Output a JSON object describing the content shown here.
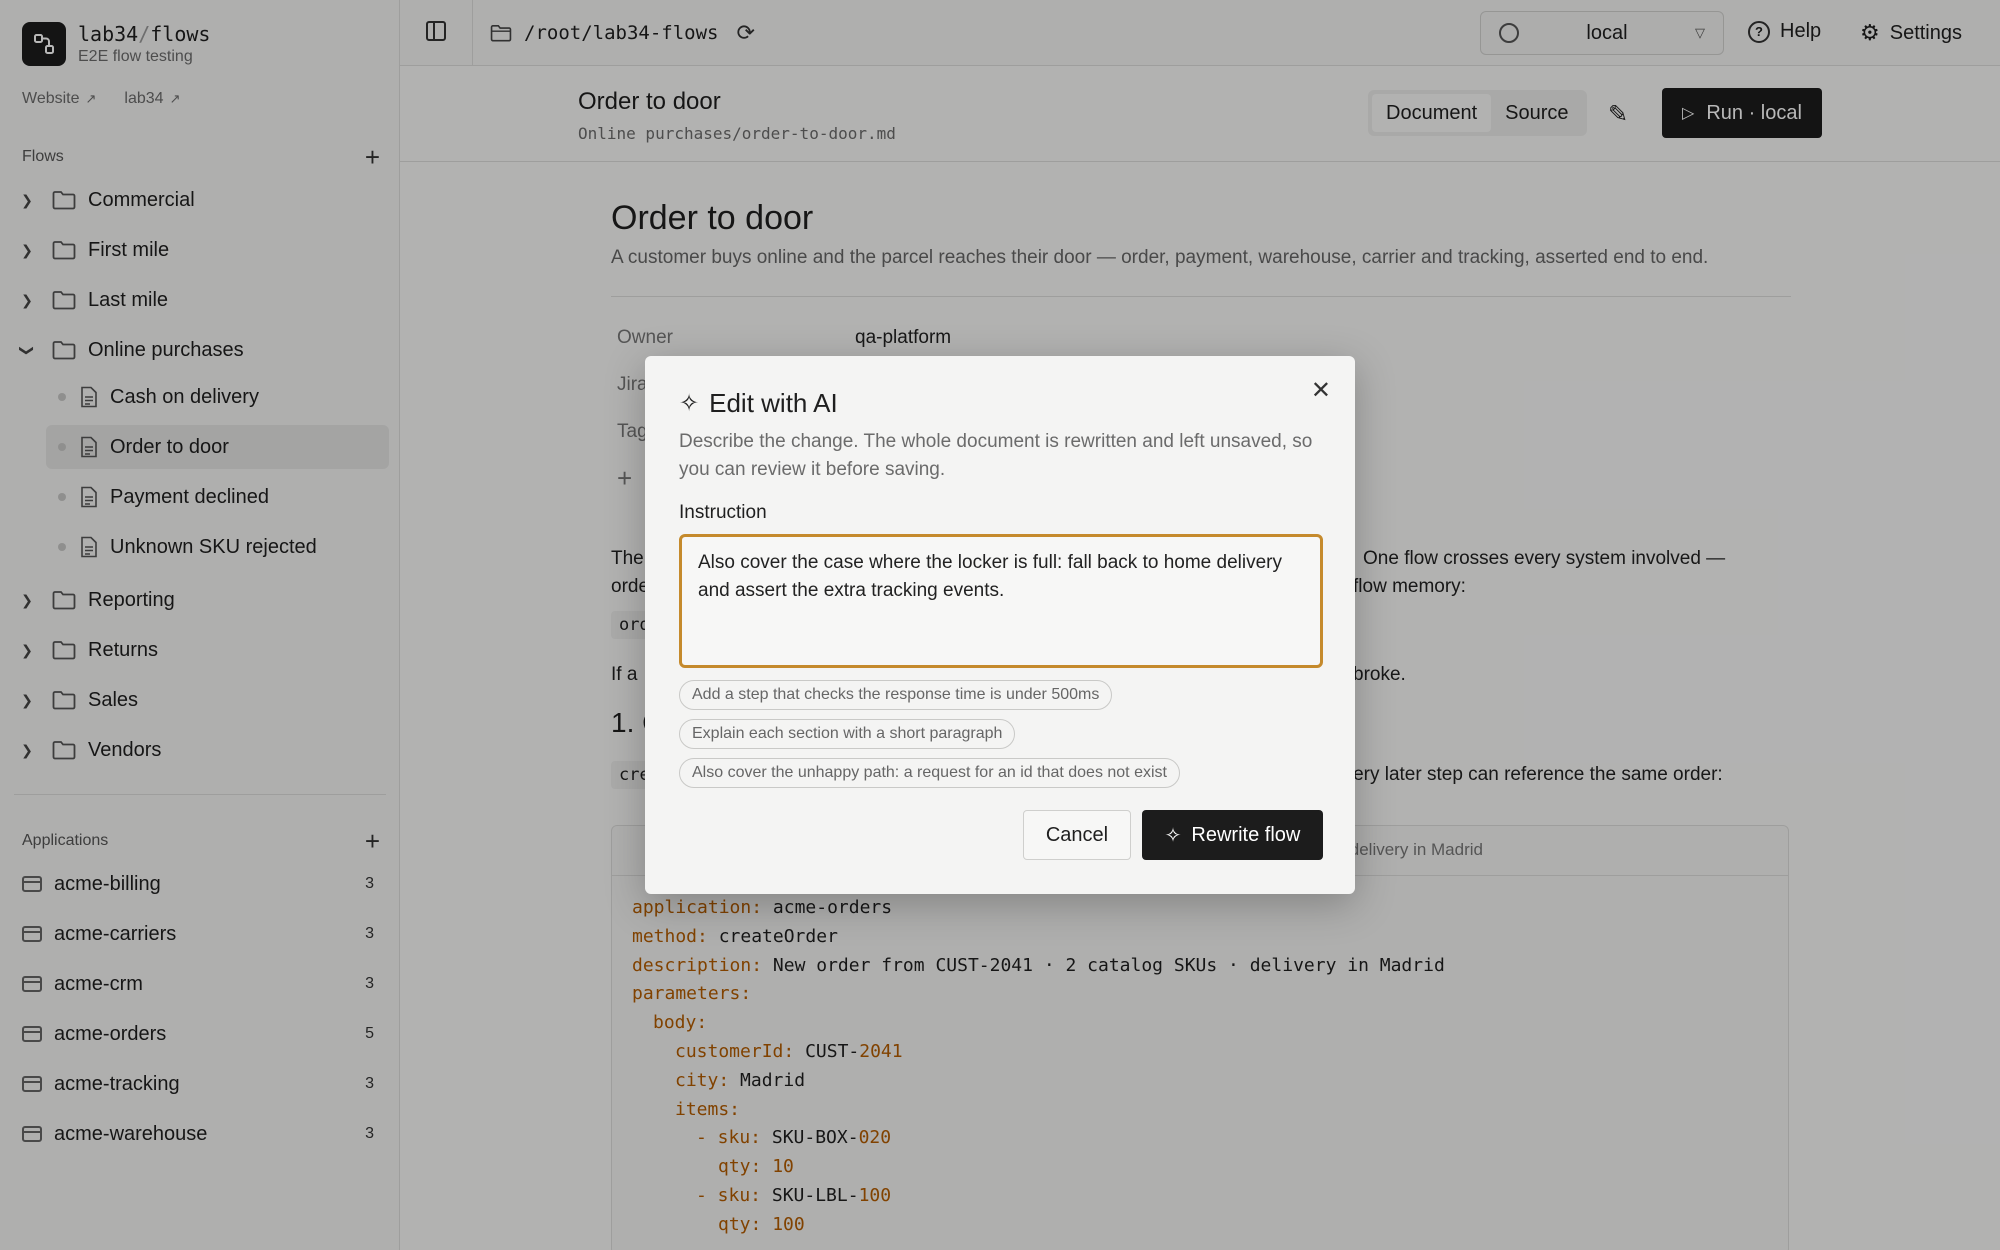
{
  "brand": {
    "org": "lab34",
    "sep": "/",
    "name": "flows",
    "subtitle": "E2E flow testing"
  },
  "links": [
    {
      "label": "Website",
      "arrow": "↗"
    },
    {
      "label": "lab34",
      "arrow": "↗"
    }
  ],
  "sidebar": {
    "flows_heading": "Flows",
    "folders_top": [
      "Commercial",
      "First mile",
      "Last mile",
      "Online purchases"
    ],
    "online_children": [
      "Cash on delivery",
      "Order to door",
      "Payment declined",
      "Unknown SKU rejected"
    ],
    "folders_bottom": [
      "Reporting",
      "Returns",
      "Sales",
      "Vendors"
    ],
    "apps_heading": "Applications",
    "apps": [
      {
        "name": "acme-billing",
        "count": "3"
      },
      {
        "name": "acme-carriers",
        "count": "3"
      },
      {
        "name": "acme-crm",
        "count": "3"
      },
      {
        "name": "acme-orders",
        "count": "5"
      },
      {
        "name": "acme-tracking",
        "count": "3"
      },
      {
        "name": "acme-warehouse",
        "count": "3"
      }
    ]
  },
  "topbar": {
    "path": "/root/lab34-flows",
    "env": "local",
    "help": "Help",
    "settings": "Settings"
  },
  "header": {
    "title": "Order to door",
    "path": "Online purchases/order-to-door.md",
    "tab_document": "Document",
    "tab_source": "Source",
    "run_label": "Run · local"
  },
  "doc": {
    "h1": "Order to door",
    "lead": "A customer buys online and the parcel reaches their door — order, payment, warehouse, carrier and tracking, asserted end to end.",
    "meta": [
      {
        "key": "Owner",
        "value": "qa-platform"
      },
      {
        "key": "Jira",
        "value": ""
      },
      {
        "key": "Tags",
        "value": ""
      }
    ],
    "para1_start": "The",
    "para1_end": "One flow crosses every system involved —",
    "para1_line2_start": "orde",
    "para1_line2_end": "flow memory:",
    "code_frag1": "ord",
    "para2_start": "If a",
    "para2_end": "broke.",
    "h2": "1. C",
    "code_frag2": "cre",
    "para3_end": "every later step can reference the same order:",
    "code_tab_desc": "delivery in Madrid",
    "code": {
      "application_k": "application:",
      "application_v": "acme-orders",
      "method_k": "method:",
      "method_v": "createOrder",
      "description_k": "description:",
      "description_v": "New order from CUST-2041 · 2 catalog SKUs · delivery in Madrid",
      "parameters_k": "parameters:",
      "body_k": "body:",
      "customerId_k": "customerId:",
      "customerId_v1": "CUST-",
      "customerId_v2": "2041",
      "city_k": "city:",
      "city_v": "Madrid",
      "items_k": "items:",
      "sku1_k": "- sku:",
      "sku1_v1": "SKU-BOX-",
      "sku1_v2": "020",
      "qty1_k": "qty:",
      "qty1_v": "10",
      "sku2_k": "- sku:",
      "sku2_v1": "SKU-LBL-",
      "sku2_v2": "100",
      "qty2_k": "qty:",
      "qty2_v": "100"
    }
  },
  "modal": {
    "title": "Edit with AI",
    "description": "Describe the change. The whole document is rewritten and left unsaved, so you can review it before saving.",
    "field_label": "Instruction",
    "instruction": "Also cover the case where the locker is full: fall back to home delivery and assert the extra tracking events.",
    "suggestions": [
      "Add a step that checks the response time is under 500ms",
      "Explain each section with a short paragraph",
      "Also cover the unhappy path: a request for an id that does not exist"
    ],
    "cancel": "Cancel",
    "submit": "Rewrite flow"
  }
}
